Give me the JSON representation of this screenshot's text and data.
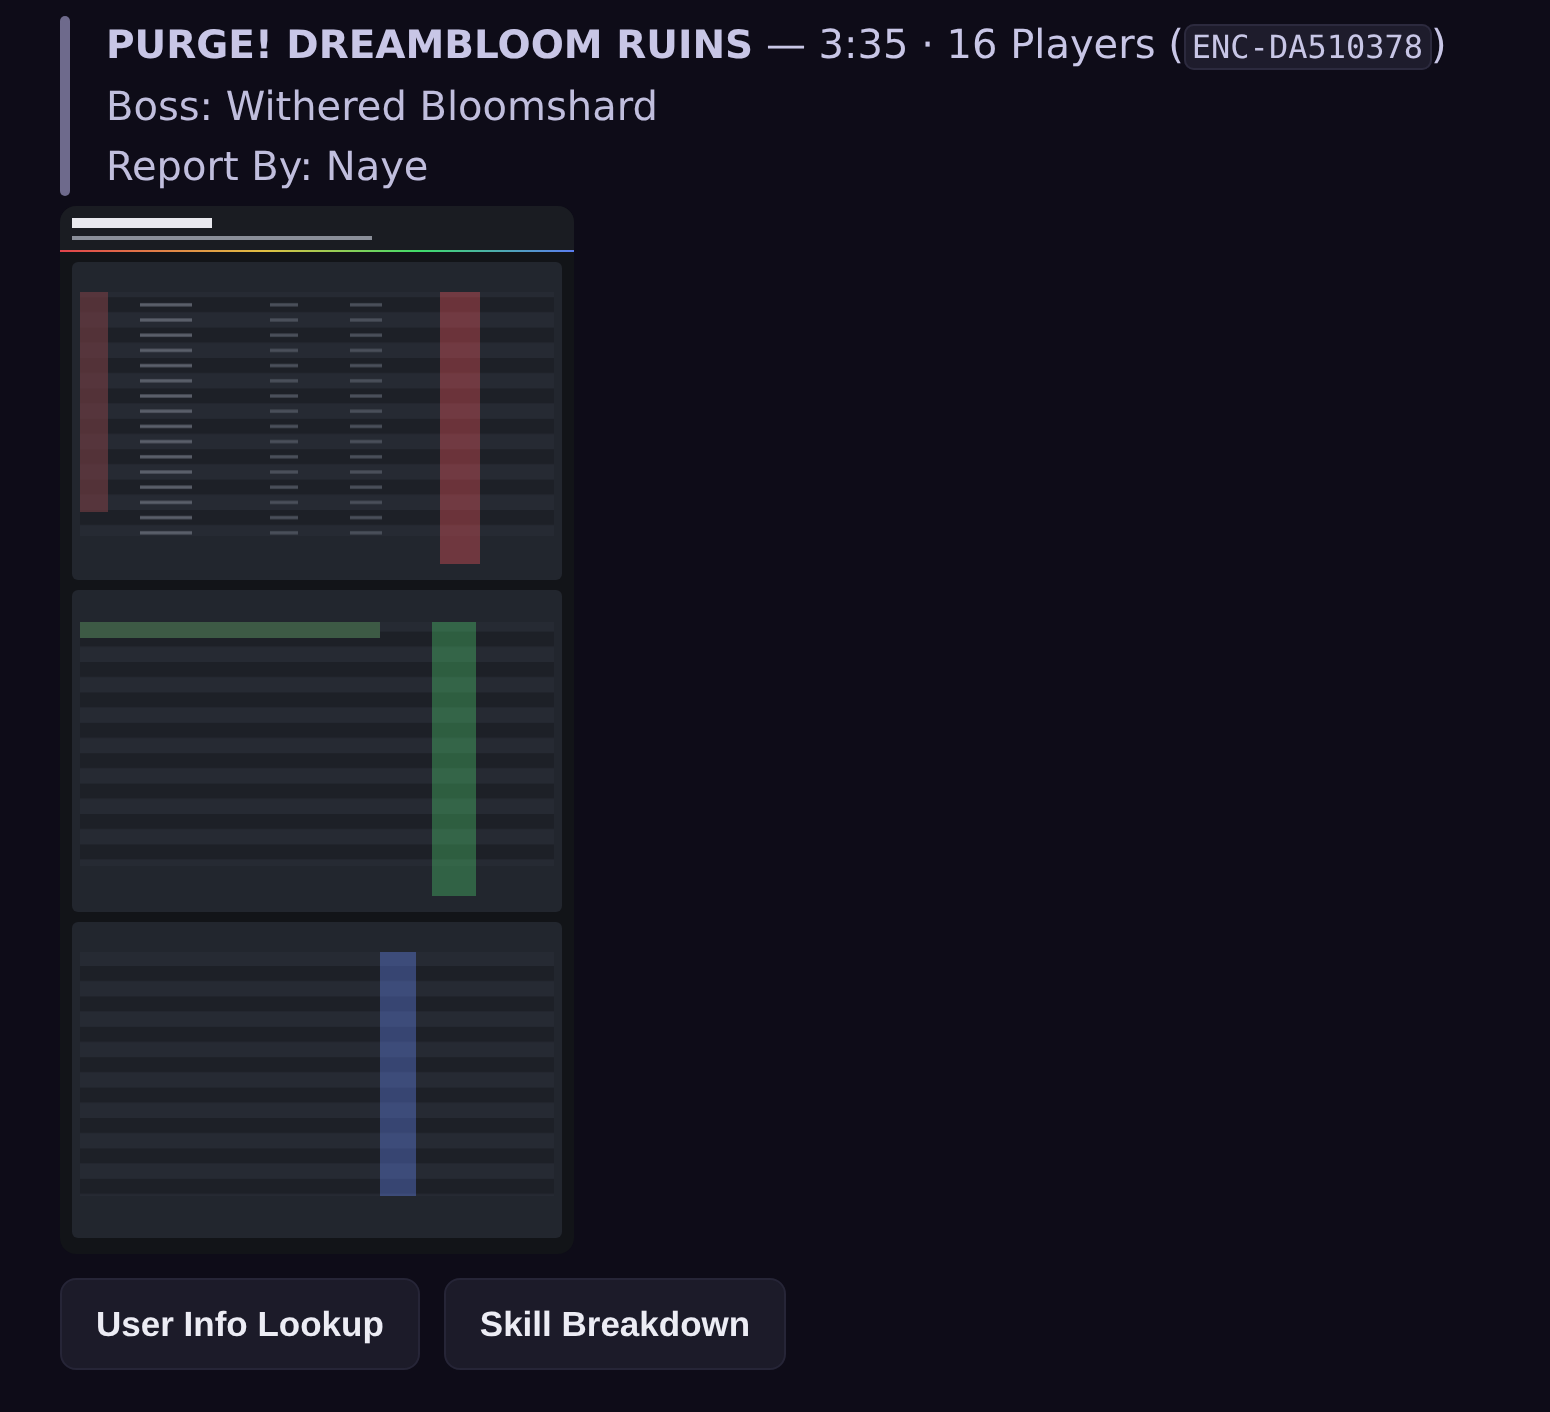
{
  "message": {
    "title": "PURGE! DREAMBLOOM RUINS",
    "title_rest": "— 3:35 · 16 Players (",
    "code": "ENC-DA510378",
    "title_end": ")",
    "lines": [
      "Boss: Withered Bloomshard",
      "Report By: Naye"
    ]
  },
  "buttons": [
    "User Info Lookup",
    "Skill Breakdown"
  ]
}
